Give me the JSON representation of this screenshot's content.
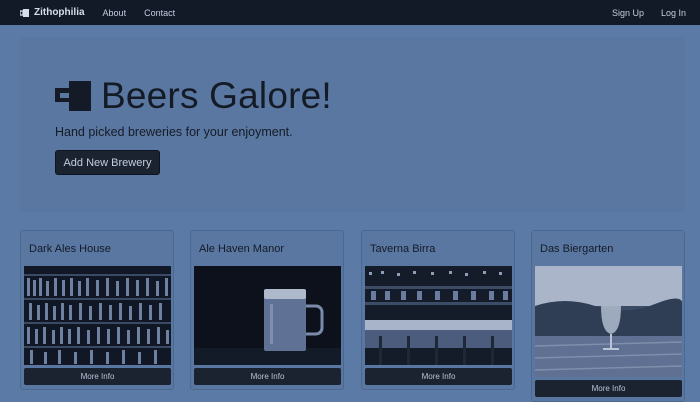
{
  "navbar": {
    "brand": "Zithophilia",
    "links": [
      "About",
      "Contact"
    ],
    "right_links": [
      "Sign Up",
      "Log In"
    ]
  },
  "hero": {
    "title": "Beers Galore!",
    "subtitle": "Hand picked breweries for your enjoyment.",
    "button_label": "Add New Brewery"
  },
  "breweries": [
    {
      "name": "Dark Ales House",
      "button_label": "More Info"
    },
    {
      "name": "Ale Haven Manor",
      "button_label": "More Info"
    },
    {
      "name": "Taverna Birra",
      "button_label": "More Info"
    },
    {
      "name": "Das Biergarten",
      "button_label": "More Info"
    }
  ],
  "colors": {
    "background": "#5b7aa5",
    "navbar": "#131a27",
    "button": "#1b2331"
  }
}
